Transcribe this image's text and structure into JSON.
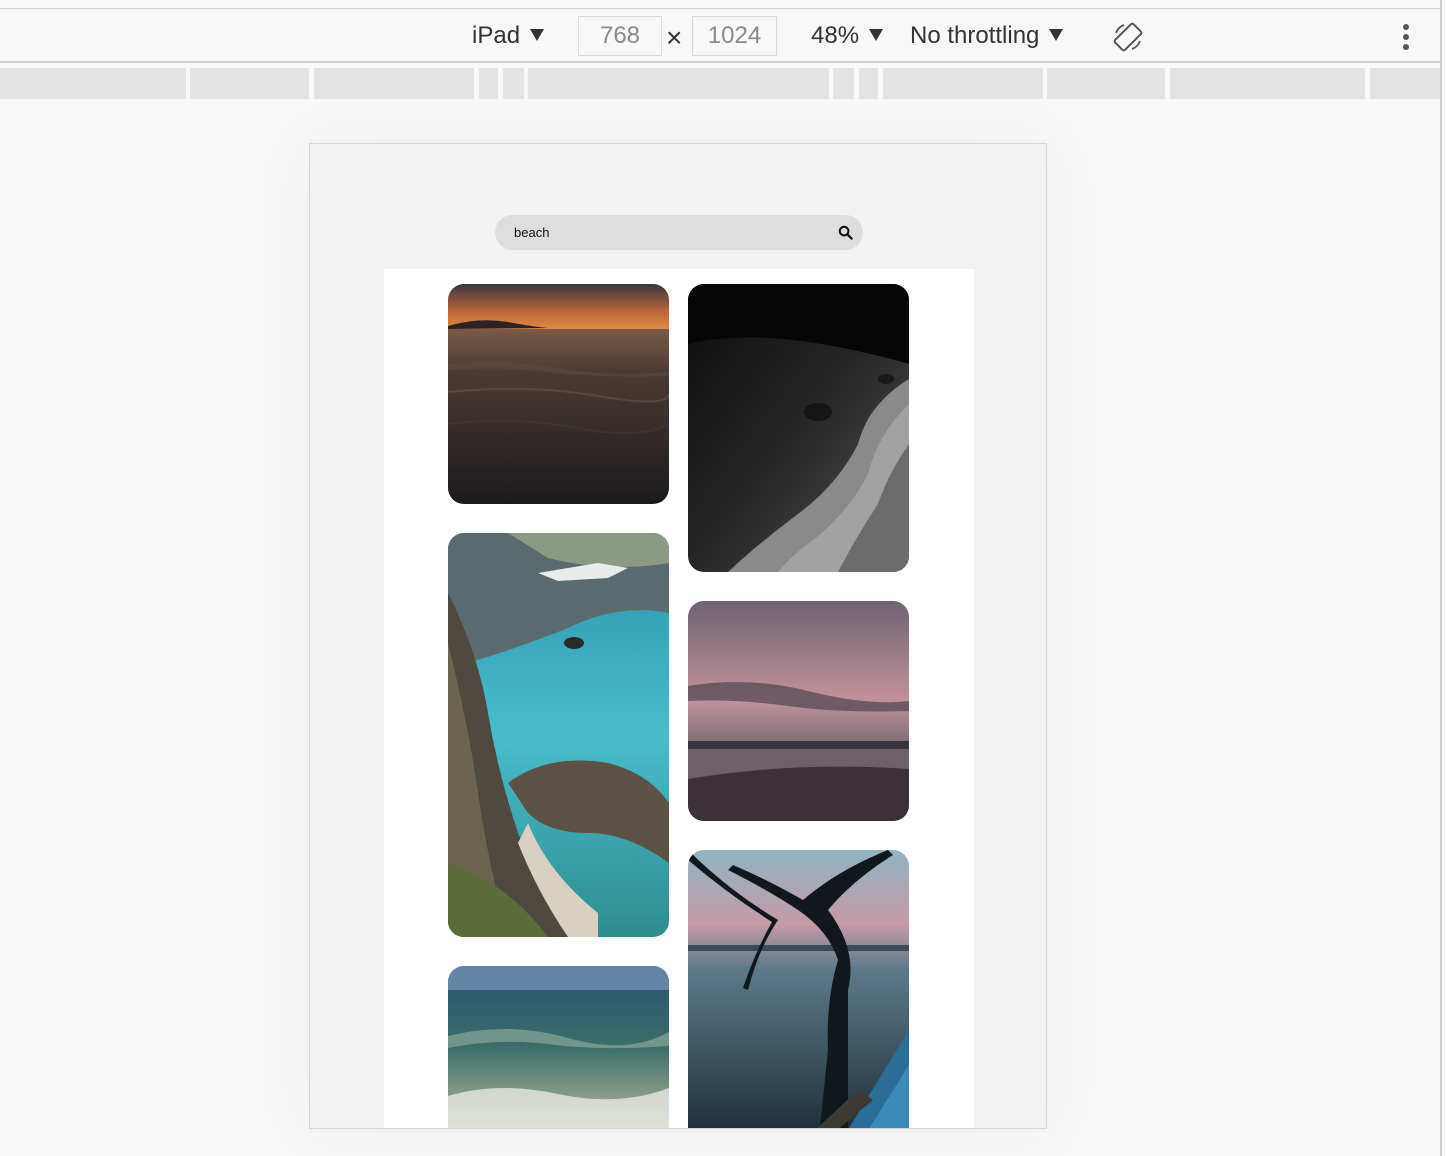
{
  "toolbar": {
    "device": "iPad",
    "width": "768",
    "times": "×",
    "height": "1024",
    "zoom": "48%",
    "throttling": "No throttling"
  },
  "search": {
    "value": "beach"
  },
  "icons": [
    "caret-down-icon",
    "rotate-icon",
    "more-vert-icon",
    "search-icon"
  ],
  "photos": [
    {
      "name": "beach-sunset-photo"
    },
    {
      "name": "black-white-shore-photo"
    },
    {
      "name": "turquoise-bay-cliffs-photo"
    },
    {
      "name": "pink-dusk-lake-photo"
    },
    {
      "name": "sea-waves-photo"
    },
    {
      "name": "tree-silhouette-pier-photo"
    }
  ]
}
